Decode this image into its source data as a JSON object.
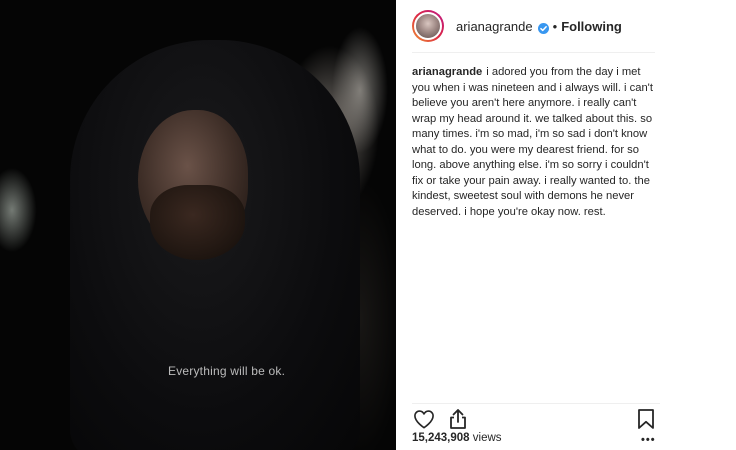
{
  "media": {
    "shirt_text": "Everything will be ok."
  },
  "header": {
    "username": "arianagrande",
    "separator": "•",
    "follow_status": "Following",
    "verified_icon": "verified-badge-icon"
  },
  "caption": {
    "username": "arianagrande",
    "text": "i adored you from the day i met you when i was nineteen and i always will. i can't believe you aren't here anymore. i really can't wrap my head around it. we talked about this. so many times. i'm so mad, i'm so sad i don't know what to do. you were my dearest friend. for so long. above anything else. i'm so sorry i couldn't fix or take your pain away. i really wanted to. the kindest, sweetest soul with demons he never deserved. i hope you're okay now. rest."
  },
  "actions": {
    "like_icon": "heart-icon",
    "share_icon": "share-icon",
    "save_icon": "bookmark-icon"
  },
  "stats": {
    "views_count": "15,243,908",
    "views_label": "views",
    "more": "•••"
  },
  "colors": {
    "text": "#262626",
    "verified": "#3897f0",
    "divider": "#efefef"
  }
}
